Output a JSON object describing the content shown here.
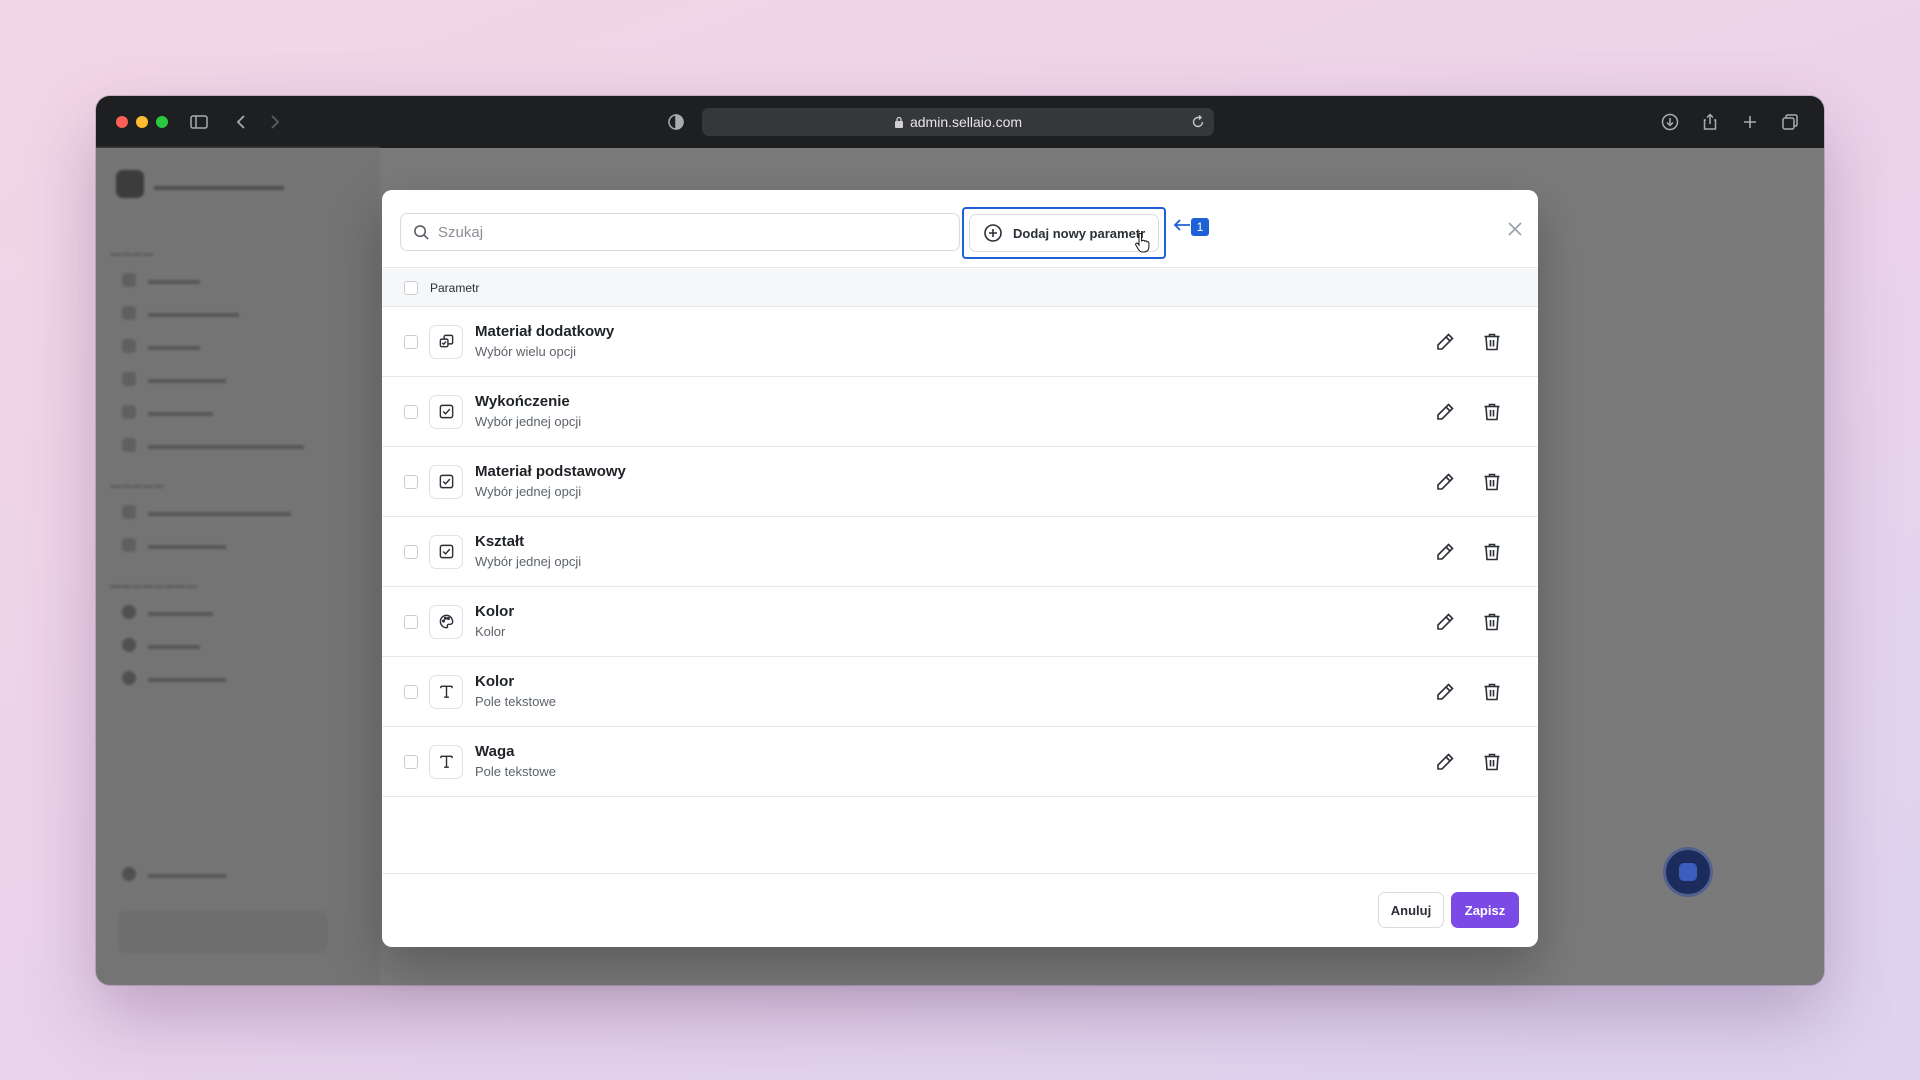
{
  "browser": {
    "url": "admin.sellaio.com"
  },
  "modal": {
    "search_placeholder": "Szukaj",
    "add_button_label": "Dodaj nowy parametr",
    "annotation_badge": "1",
    "table_header": "Parametr",
    "rows": [
      {
        "name": "Materiał dodatkowy",
        "type": "Wybór wielu opcji",
        "icon": "multi-select-icon"
      },
      {
        "name": "Wykończenie",
        "type": "Wybór jednej opcji",
        "icon": "checkbox-icon"
      },
      {
        "name": "Materiał podstawowy",
        "type": "Wybór jednej opcji",
        "icon": "checkbox-icon"
      },
      {
        "name": "Kształt",
        "type": "Wybór jednej opcji",
        "icon": "checkbox-icon"
      },
      {
        "name": "Kolor",
        "type": "Kolor",
        "icon": "palette-icon"
      },
      {
        "name": "Kolor",
        "type": "Pole tekstowe",
        "icon": "text-icon"
      },
      {
        "name": "Waga",
        "type": "Pole tekstowe",
        "icon": "text-icon"
      }
    ],
    "cancel_label": "Anuluj",
    "save_label": "Zapisz"
  },
  "colors": {
    "accent": "#7b49e6",
    "annotation": "#1e60d6"
  }
}
